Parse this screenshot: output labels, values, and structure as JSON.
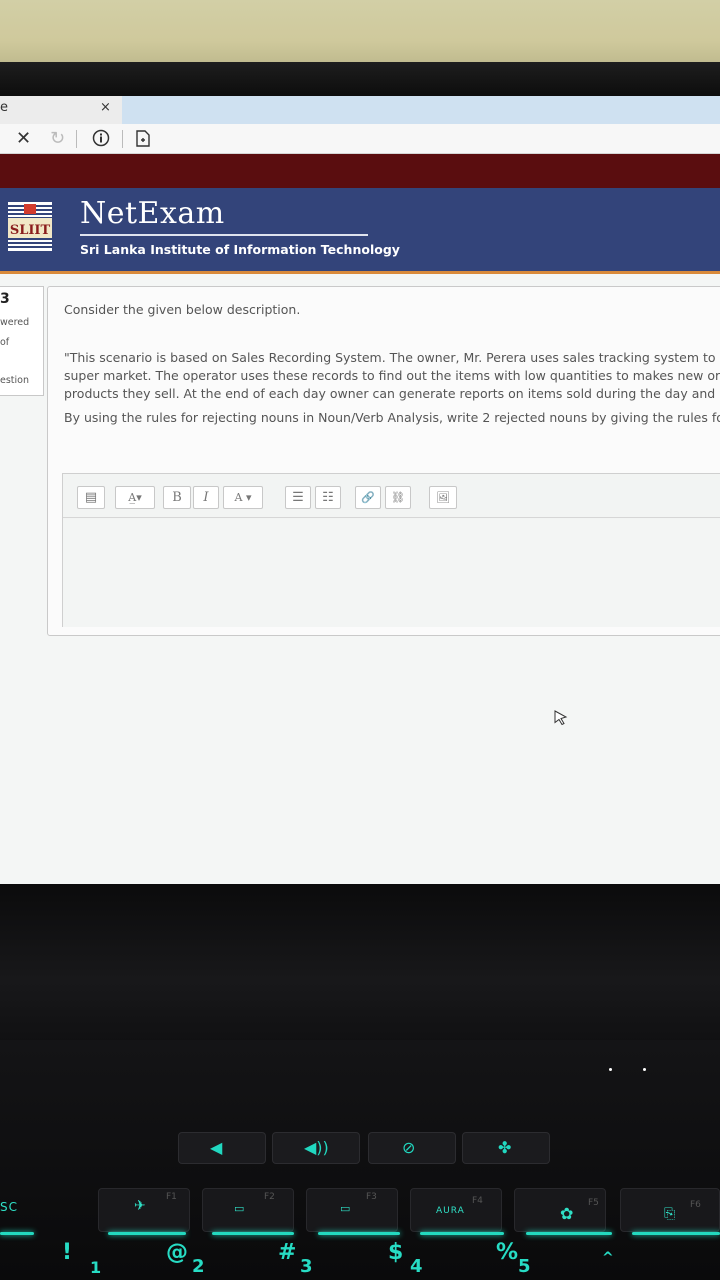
{
  "browser": {
    "tab_label": "e",
    "tab_close": "×",
    "stop_icon": "stop-icon",
    "refresh_icon": "refresh-icon",
    "info_icon": "info-icon",
    "page_icon": "page-icon"
  },
  "header": {
    "logo_text": "SLIIT",
    "brand": "NetExam",
    "subtitle": "Sri Lanka Institute of Information Technology",
    "bg_color": "#33447a",
    "accent_color": "#d98a3a"
  },
  "question_info": {
    "number": "3",
    "status": "wered",
    "marks": "of",
    "flag": "estion"
  },
  "question": {
    "intro": "Consider the given below description.",
    "scenario_lines": [
      "\"This scenario is based on Sales Recording System.  The owner, Mr. Perera uses sales tracking system to ma",
      "super market. The operator uses these records to find out the items with low quantities to makes new orde",
      "products they sell. At the end of each day owner can generate reports on items sold during the day and ab"
    ],
    "instruction": "By using the rules for rejecting nouns in Noun/Verb Analysis, write 2 rejected nouns by giving the rules for y"
  },
  "editor": {
    "buttons": [
      {
        "name": "paragraph-format-icon",
        "label": "▤"
      },
      {
        "name": "font-size-dropdown",
        "label": "A̲▾"
      },
      {
        "name": "bold-button",
        "label": "B"
      },
      {
        "name": "italic-button",
        "label": "I"
      },
      {
        "name": "font-color-dropdown",
        "label": "A ▾"
      },
      {
        "name": "bullet-list-icon",
        "label": "☰"
      },
      {
        "name": "numbered-list-icon",
        "label": "☷"
      },
      {
        "name": "link-icon",
        "label": "🔗"
      },
      {
        "name": "unlink-icon",
        "label": "⛓"
      },
      {
        "name": "image-icon",
        "label": "🖼"
      }
    ],
    "content": ""
  },
  "keyboard": {
    "esc": "SC",
    "f1": "F1",
    "f2": "F2",
    "f3": "F3",
    "f4": "F4",
    "f5": "F5",
    "f6": "F6",
    "aura": "AURA",
    "num_row": [
      "!",
      "@",
      "#",
      "$",
      "%",
      "^"
    ],
    "num_digits": [
      "1",
      "2",
      "3",
      "4",
      "5"
    ],
    "glow_color": "#23d9bf"
  }
}
